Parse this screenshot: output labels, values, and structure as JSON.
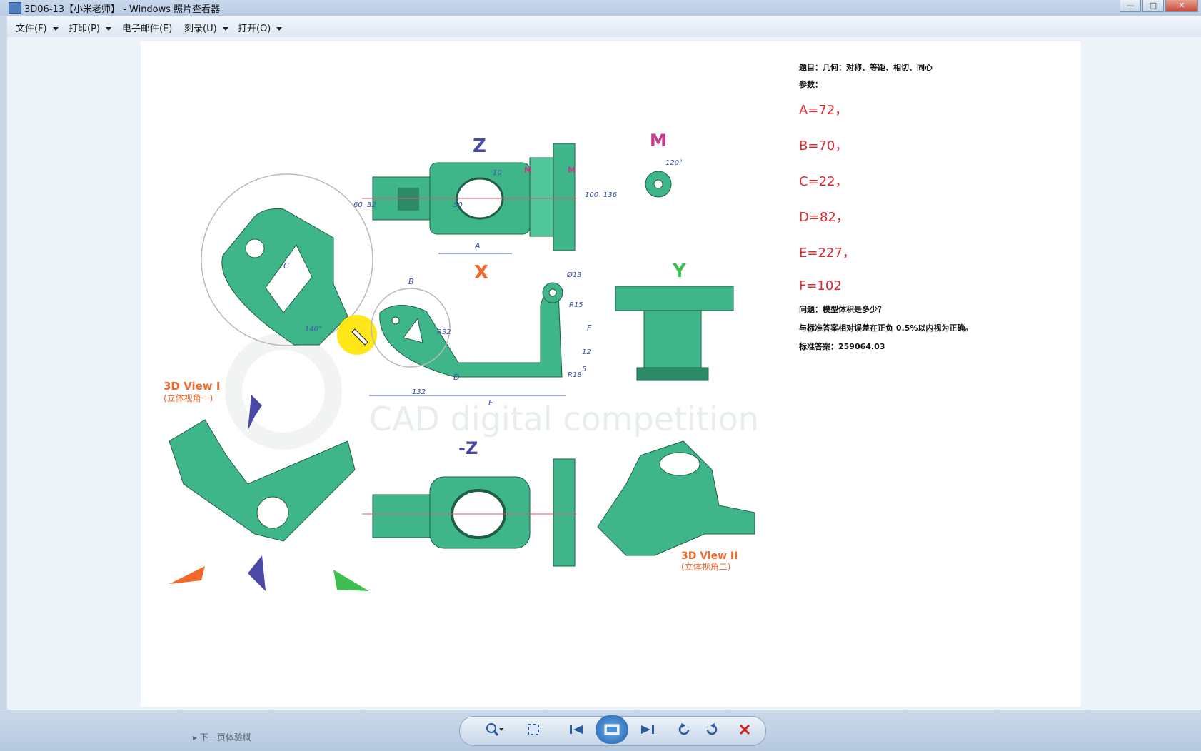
{
  "window": {
    "title": "3D06-13【小米老师】 - Windows 照片查看器",
    "controls": [
      "—",
      "□",
      "✕"
    ]
  },
  "menu": [
    {
      "label": "文件(F)",
      "has_dropdown": true
    },
    {
      "label": "打印(P)",
      "has_dropdown": true
    },
    {
      "label": "电子邮件(E)",
      "has_dropdown": false
    },
    {
      "label": "刻录(U)",
      "has_dropdown": true
    },
    {
      "label": "打开(O)",
      "has_dropdown": true
    }
  ],
  "drawing": {
    "view_labels": {
      "z": "Z",
      "m": "M",
      "x": "X",
      "y": "Y",
      "minus_z": "-Z",
      "view1": "3D View I",
      "view1_cn": "(立体视角一)",
      "view2": "3D View II",
      "view2_cn": "(立体视角二)"
    },
    "watermark": "CAD digital competition",
    "dimensions": {
      "angle_120": "120°",
      "dia_13": "Ø13",
      "r15": "R15",
      "r18": "R18",
      "r32": "R32",
      "d60": "60",
      "d32": "32",
      "d50": "50",
      "d10": "10",
      "d100": "100",
      "d136": "136",
      "d12": "12",
      "d5": "5",
      "d132": "132",
      "d140": "140°",
      "dim_A": "A",
      "dim_B": "B",
      "dim_C": "C",
      "dim_D": "D",
      "dim_E": "E",
      "dim_F": "F"
    },
    "colors": {
      "model": "#3fb68a",
      "model_dark": "#2c8a66",
      "label_blue": "#4a4aa6",
      "label_magenta": "#c43a8c",
      "label_orange": "#ef6a2a",
      "label_green": "#3fbf4f",
      "dim": "#3b52a8"
    }
  },
  "question": {
    "topic": "题目：几何：对称、等距、相切、同心",
    "params_label": "参数：",
    "params": [
      "A=72，",
      "B=70，",
      "C=22，",
      "D=82，",
      "E=227，",
      "F=102"
    ],
    "question": "问题：模型体积是多少？",
    "tolerance": "与标准答案相对误差在正负 0.5%以内视为正确。",
    "answer": "标准答案：259064.03"
  },
  "toolbar": {
    "zoom_icon": "zoom-icon",
    "fit_icon": "fit-icon",
    "prev_icon": "previous-icon",
    "slideshow_icon": "slideshow-icon",
    "next_icon": "next-icon",
    "rotate_ccw_icon": "rotate-ccw-icon",
    "rotate_cw_icon": "rotate-cw-icon",
    "delete_icon": "delete-icon"
  },
  "taskbar_hint": "▸ 下一页体验概"
}
